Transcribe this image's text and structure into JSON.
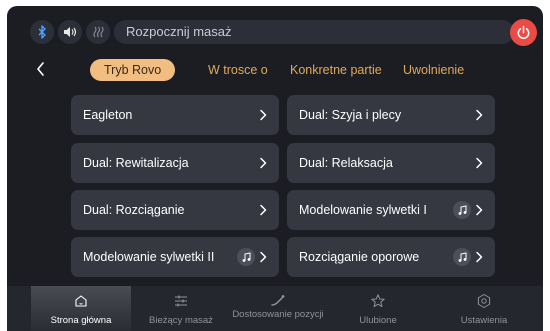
{
  "colors": {
    "background": "#1b1d23",
    "card": "#353841",
    "accent": "#f2bd80",
    "tab_text": "#e0a95c",
    "power": "#ea4b45"
  },
  "topbar": {
    "icons": [
      "bluetooth-icon",
      "volume-icon",
      "heat-icon"
    ],
    "search_text": "Rozpocznij masaż",
    "power_icon": "power-icon"
  },
  "tabs": [
    {
      "label": "Tryb Rovo",
      "active": true
    },
    {
      "label": "W trosce o",
      "active": false
    },
    {
      "label": "Konkretne partie",
      "active": false
    },
    {
      "label": "Uwolnienie",
      "active": false
    }
  ],
  "cards": [
    {
      "label": "Eagleton",
      "music": false
    },
    {
      "label": "Dual: Szyja i plecy",
      "music": false
    },
    {
      "label": "Dual: Rewitalizacja",
      "music": false
    },
    {
      "label": "Dual: Relaksacja",
      "music": false
    },
    {
      "label": "Dual: Rozciąganie",
      "music": false
    },
    {
      "label": "Modelowanie sylwetki I",
      "music": true
    },
    {
      "label": "Modelowanie sylwetki II",
      "music": true
    },
    {
      "label": "Rozciąganie oporowe",
      "music": true
    }
  ],
  "nav": [
    {
      "label": "Strona główna",
      "icon": "home-icon",
      "active": true
    },
    {
      "label": "Bieżący masaż",
      "icon": "sliders-icon",
      "active": false
    },
    {
      "label": "Dostosowanie pozycji",
      "icon": "recline-icon",
      "active": false
    },
    {
      "label": "Ulubione",
      "icon": "star-icon",
      "active": false
    },
    {
      "label": "Ustawienia",
      "icon": "gear-icon",
      "active": false
    }
  ]
}
